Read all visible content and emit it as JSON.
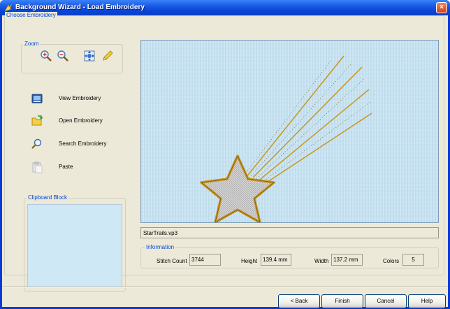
{
  "window": {
    "title": "Background Wizard - Load Embroidery",
    "close_label": "×"
  },
  "groups": {
    "choose": "Choose Embroidery",
    "zoom": "Zoom",
    "clipboard": "Clipboard Block",
    "information": "Information"
  },
  "zoom_buttons": [
    {
      "name": "zoom-in-icon"
    },
    {
      "name": "zoom-out-icon"
    },
    {
      "name": "zoom-fit-icon"
    },
    {
      "name": "pencil-icon"
    }
  ],
  "actions": [
    {
      "label": "View Embroidery",
      "icon": "view-icon"
    },
    {
      "label": "Open Embroidery",
      "icon": "open-folder-icon"
    },
    {
      "label": "Search Embroidery",
      "icon": "search-icon"
    },
    {
      "label": "Paste",
      "icon": "paste-icon"
    }
  ],
  "file_name": "StarTrails.vp3",
  "info": {
    "stitch_count_label": "Stitch Count",
    "stitch_count": "3744",
    "height_label": "Height",
    "height": "139.4 mm",
    "width_label": "Width",
    "width": "137.2 mm",
    "colors_label": "Colors",
    "colors": "5"
  },
  "buttons": {
    "back": "< Back",
    "finish": "Finish",
    "cancel": "Cancel",
    "help": "Help"
  },
  "colors": {
    "fabric": "#c9e3f1",
    "gold": "#c8961e",
    "star_fill": "#d8d8d8"
  }
}
